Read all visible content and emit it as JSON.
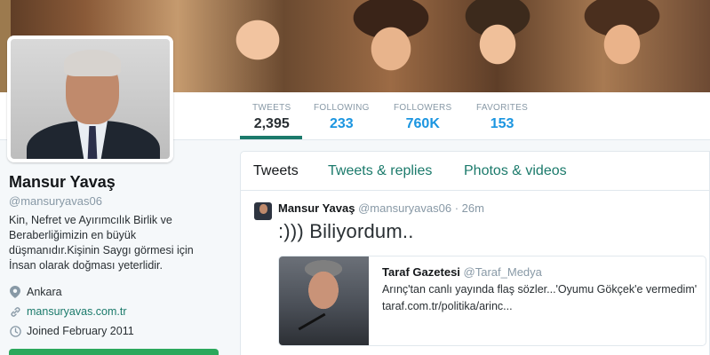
{
  "profile": {
    "name": "Mansur Yavaş",
    "handle": "@mansuryavas06",
    "bio": "Kin, Nefret ve Ayırımcılık Birlik ve Beraberliğimizin en büyük düşmanıdır.Kişinin Saygı görmesi için İnsan olarak doğması yeterlidir.",
    "location": "Ankara",
    "website": "mansuryavas.com.tr",
    "joined": "Joined February 2011"
  },
  "stats": [
    {
      "label": "TWEETS",
      "value": "2,395"
    },
    {
      "label": "FOLLOWING",
      "value": "233"
    },
    {
      "label": "FOLLOWERS",
      "value": "760K"
    },
    {
      "label": "FAVORITES",
      "value": "153"
    }
  ],
  "tabs": [
    "Tweets",
    "Tweets & replies",
    "Photos & videos"
  ],
  "tweet": {
    "author": "Mansur Yavaş",
    "handle": "@mansuryavas06",
    "time": "· 26m",
    "text": ":)))  Biliyordum..",
    "card": {
      "source_name": "Taraf Gazetesi",
      "source_handle": "@Taraf_Medya",
      "description": "Arınç'tan canlı yayında flaş sözler...'Oyumu Gökçek'e vermedim'",
      "url": "taraf.com.tr/politika/arinc..."
    }
  },
  "icons": {
    "location": "map-pin-icon",
    "website": "link-icon",
    "joined": "calendar-icon"
  },
  "colors": {
    "link": "#1b7a6b",
    "stat_value": "#1b95e0",
    "button": "#2ba85c"
  }
}
